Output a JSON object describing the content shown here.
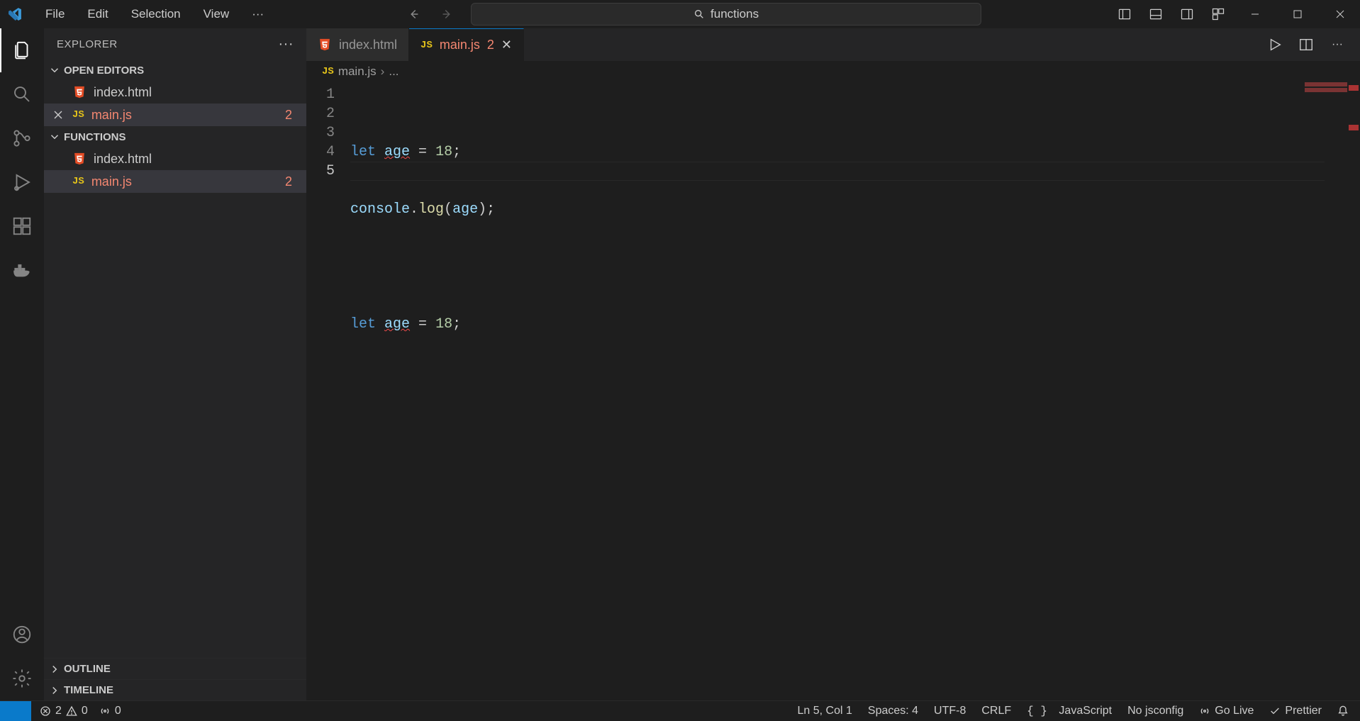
{
  "menu": {
    "file": "File",
    "edit": "Edit",
    "selection": "Selection",
    "view": "View"
  },
  "search_placeholder": "functions",
  "sidebar": {
    "title": "Explorer",
    "open_editors_label": "Open Editors",
    "folder_label": "Functions",
    "outline_label": "Outline",
    "timeline_label": "Timeline",
    "open_editors": [
      {
        "name": "index.html",
        "type": "html",
        "error": false,
        "badge": ""
      },
      {
        "name": "main.js",
        "type": "js",
        "error": true,
        "badge": "2"
      }
    ],
    "folder_files": [
      {
        "name": "index.html",
        "type": "html",
        "error": false,
        "badge": ""
      },
      {
        "name": "main.js",
        "type": "js",
        "error": true,
        "badge": "2"
      }
    ]
  },
  "tabs": [
    {
      "name": "index.html",
      "type": "html",
      "active": false,
      "badge": ""
    },
    {
      "name": "main.js",
      "type": "js",
      "active": true,
      "badge": "2"
    }
  ],
  "breadcrumb": {
    "file": "main.js",
    "trail": "..."
  },
  "code": {
    "lines": [
      "1",
      "2",
      "3",
      "4",
      "5"
    ],
    "l1": {
      "kw": "let",
      "var": "age",
      "rest": " = ",
      "num": "18",
      "semi": ";"
    },
    "l2": {
      "obj": "console",
      "dot": ".",
      "fn": "log",
      "open": "(",
      "arg": "age",
      "close": ")",
      "semi": ";"
    },
    "l4": {
      "kw": "let",
      "var": "age",
      "rest": " = ",
      "num": "18",
      "semi": ";"
    }
  },
  "status": {
    "errors": "2",
    "warnings": "0",
    "ports": "0",
    "position": "Ln 5, Col 1",
    "spaces": "Spaces: 4",
    "encoding": "UTF-8",
    "eol": "CRLF",
    "language": "JavaScript",
    "jsconfig": "No jsconfig",
    "golive": "Go Live",
    "prettier": "Prettier"
  }
}
